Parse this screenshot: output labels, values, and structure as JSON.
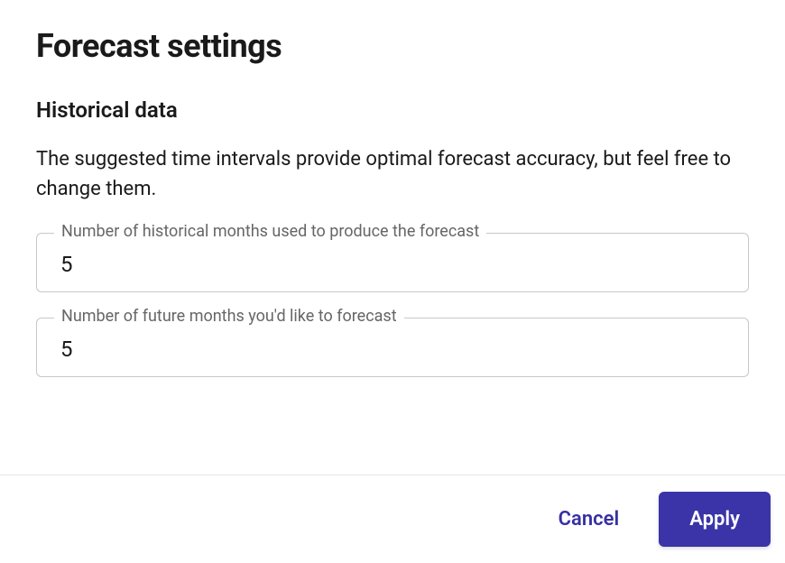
{
  "title": "Forecast settings",
  "section": {
    "heading": "Historical data",
    "description": "The suggested time intervals provide optimal forecast accuracy, but feel free to change them."
  },
  "fields": {
    "historical": {
      "label": "Number of historical months used to produce the forecast",
      "value": "5"
    },
    "future": {
      "label": "Number of future months you'd like to forecast",
      "value": "5"
    }
  },
  "buttons": {
    "cancel": "Cancel",
    "apply": "Apply"
  }
}
